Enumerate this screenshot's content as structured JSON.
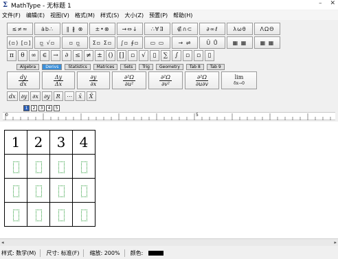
{
  "window": {
    "title": "MathType - 无标题 1",
    "app_icon_glyph": "Σ",
    "minimize_glyph": "–",
    "close_glyph": "✕"
  },
  "menu": [
    "文件(F)",
    "编辑(E)",
    "视图(V)",
    "格式(M)",
    "样式(S)",
    "大小(Z)",
    "预置(P)",
    "帮助(H)"
  ],
  "palettes_row1": [
    "≤≠≈",
    "ȧb∴",
    "∥ ∦ ⊗",
    "±•⊗",
    "→⇔↓",
    "∴∀∃",
    "∉∩⊂",
    "∂∞ℓ",
    "λωθ",
    "ΛΩΘ"
  ],
  "palettes_row2": [
    "(▫) [▫]",
    "▫̲ √▫",
    "▫ ▫̲",
    "Σ▫ Σ▫",
    "∫▫ ∮▫",
    "▭ ▭",
    "→ ⇌",
    "Ū Ů",
    "▦ ▦",
    "▦ ▦"
  ],
  "symbols_row": [
    "π",
    "θ",
    "∞",
    "∈",
    "→",
    "∂",
    "≤",
    "≠",
    "±",
    "()",
    "[]",
    "▫",
    "√",
    "▯",
    "∑",
    "∫",
    "▫",
    "▫",
    "▯"
  ],
  "tabs": [
    {
      "label": "Algebra",
      "active": false
    },
    {
      "label": "Derivs",
      "active": true
    },
    {
      "label": "Statistics",
      "active": false
    },
    {
      "label": "Matrices",
      "active": false
    },
    {
      "label": "Sets",
      "active": false
    },
    {
      "label": "Trig",
      "active": false
    },
    {
      "label": "Geometry",
      "active": false
    },
    {
      "label": "Tab 8",
      "active": false
    },
    {
      "label": "Tab 9",
      "active": false
    }
  ],
  "templates": [
    {
      "num": "dy",
      "den": "dx"
    },
    {
      "num": "Δy",
      "den": "Δx"
    },
    {
      "num": "∂y",
      "den": "∂x"
    },
    {
      "num": "∂²Ω",
      "den": "∂u²"
    },
    {
      "num": "∂²Ω",
      "den": "∂v²"
    },
    {
      "num": "∂²Ω",
      "den": "∂u∂v"
    },
    {
      "num": "lim",
      "den": "δx→0"
    }
  ],
  "small_buttons": [
    "dx",
    "∂y",
    "∂x",
    "∂y",
    "R",
    "⋯",
    "x̄",
    "X̄"
  ],
  "size_selector": [
    {
      "label": "1",
      "active": true
    },
    {
      "label": "2",
      "active": false
    },
    {
      "label": "3",
      "active": false
    },
    {
      "label": "4",
      "active": false
    },
    {
      "label": "5",
      "active": false
    }
  ],
  "ruler": {
    "labels": [
      "0",
      "5"
    ]
  },
  "matrix": {
    "header_row": [
      "1",
      "2",
      "3",
      "4"
    ],
    "empty_rows": 3
  },
  "statusbar": {
    "style": "样式: 数学(M)",
    "size": "尺寸: 标准(F)",
    "zoom": "缩放: 200%",
    "color_label": "颜色:",
    "color_value": "#000000"
  },
  "colors": {
    "active_tab": "#3b8fd9",
    "slot_border": "#2b9c3a",
    "title_icon": "#1f3c88"
  }
}
